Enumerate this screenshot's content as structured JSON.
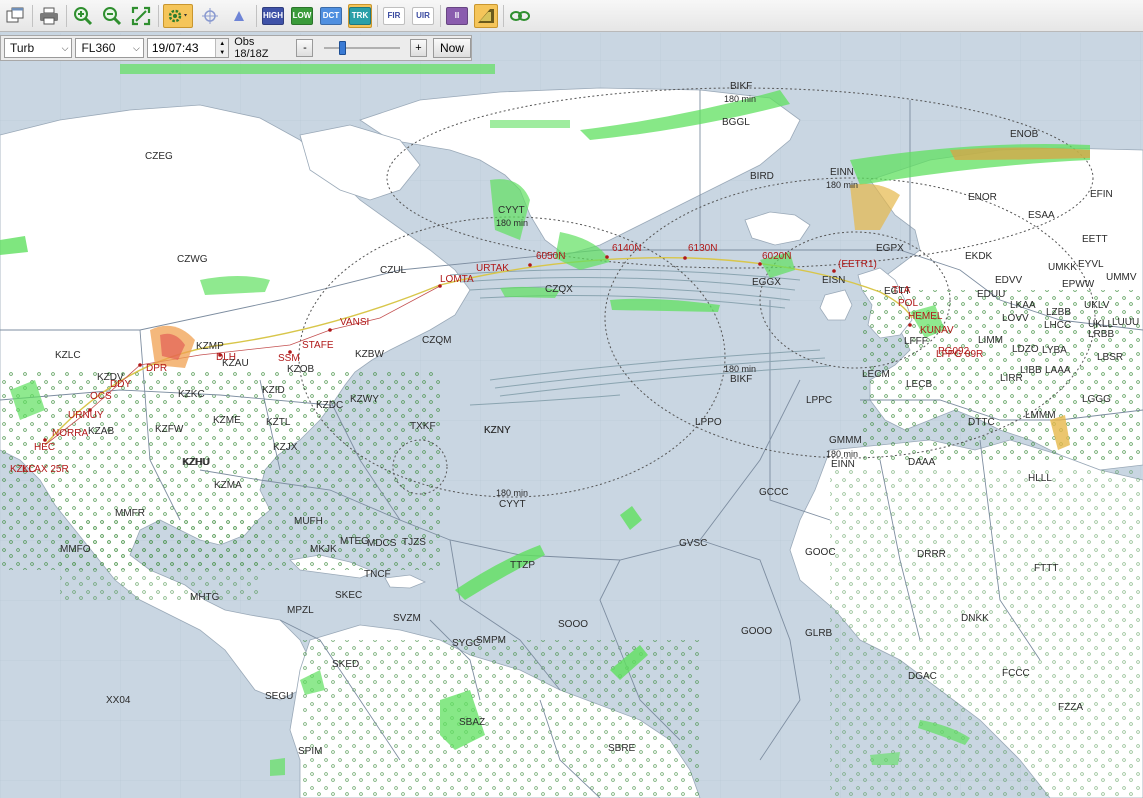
{
  "toolbar": {
    "buttons": [
      {
        "icon": "window-icon"
      },
      {
        "icon": "print-icon"
      },
      {
        "icon": "zoom-in-icon"
      },
      {
        "icon": "zoom-out-icon"
      },
      {
        "icon": "fit-view-icon"
      },
      {
        "icon": "settings-gear-icon",
        "active": true
      },
      {
        "icon": "crosshair-icon"
      },
      {
        "icon": "triangle-icon"
      }
    ],
    "tags": [
      {
        "label": "HIGH",
        "color": "#3f52a8"
      },
      {
        "label": "LOW",
        "color": "#3a9b3a"
      },
      {
        "label": "DCT",
        "color": "#4f8fe0"
      },
      {
        "label": "TRK",
        "color": "#2aa0a8",
        "active": true
      },
      {
        "label": "FIR",
        "color": "#5060b0"
      },
      {
        "label": "UIR",
        "color": "#5060b0"
      },
      {
        "label": "II",
        "color": "#8a5cae"
      }
    ],
    "extra_icons": [
      "weather-layer-icon",
      "link-icon"
    ]
  },
  "filterbar": {
    "layer": "Turb",
    "level": "FL360",
    "time": "19/07:43",
    "obs": "Obs 18/18Z",
    "minus": "-",
    "plus": "+",
    "now": "Now",
    "slider_fraction": 0.2
  },
  "map": {
    "range_labels": {
      "bikf_top": "BIKF",
      "bikf_top_min": "180 min",
      "einn": "EINN",
      "einn_min": "180 min",
      "cyyt": "CYYT",
      "cyyt_min": "180 min",
      "bikf_bottom_min": "180 min",
      "bikf_bottom": "BIKF",
      "einn_bottom_min": "180 min",
      "einn_bottom": "EINN",
      "cyyt_bottom_min": "180 min",
      "cyyt_bottom": "CYYT"
    },
    "fir_labels": [
      "BGGL",
      "ENOB",
      "CZEG",
      "BIRD",
      "ENOR",
      "EFIN",
      "ESAA",
      "EETT",
      "CZWG",
      "CZUL",
      "CZQX",
      "EGPX",
      "EKDK",
      "UMKK",
      "EYVL",
      "UMMV",
      "EGGX",
      "EISN",
      "EGTT",
      "EDUU",
      "LKAA",
      "UKLV",
      "EPWW",
      "EDVV",
      "LOVV",
      "LHCC",
      "UKLL",
      "LUUU",
      "LZBB",
      "LRBB",
      "LDZO",
      "LYBA",
      "LBSR",
      "LIMM",
      "LIBB",
      "LAAA",
      "LGGG",
      "LIRR",
      "KZLC",
      "KZMP",
      "KZAU",
      "KZDV",
      "KZOB",
      "KZBW",
      "CZQM",
      "KZID",
      "KZKC",
      "KZDC",
      "KZNY",
      "KZWY",
      "KZME",
      "KZTL",
      "KZFW",
      "KZAB",
      "KZJX",
      "KZHU",
      "KZMA",
      "MMFR",
      "MMFO",
      "MUFH",
      "MKJK",
      "MTEG",
      "MDCS",
      "TJZS",
      "TTZP",
      "GVSC",
      "TNCF",
      "MHTG",
      "MPZL",
      "SKEC",
      "SVZM",
      "SMPM",
      "SYGC",
      "SOOO",
      "GOOO",
      "GLRB",
      "SKED",
      "SEGU",
      "SBAZ",
      "SPIM",
      "SBRE",
      "XX04",
      "DGAC",
      "FCCC",
      "FZZA",
      "DNKK",
      "FTTT",
      "DRRR",
      "GOOC",
      "HLLL",
      "DAAA",
      "GMMM",
      "DTTC",
      "LMMM",
      "LECM",
      "LECB",
      "LPPC",
      "LPPO",
      "LFFF",
      "GCCC",
      "TXKF",
      "KZHU",
      "KZNY"
    ],
    "route_labels": [
      "KLAX 25R",
      "HEC",
      "NORRA",
      "URNUY",
      "OCS",
      "DDY",
      "DPR",
      "DLH",
      "SSM",
      "STAFE",
      "VANSI",
      "LOMTA",
      "URTAK",
      "6050N",
      "6140N",
      "6130N",
      "6020N",
      "(EETR1)",
      "TLA",
      "POL",
      "HEMEL",
      "KUNAV",
      "PG092",
      "LFPG 09R",
      "KZLC"
    ]
  }
}
